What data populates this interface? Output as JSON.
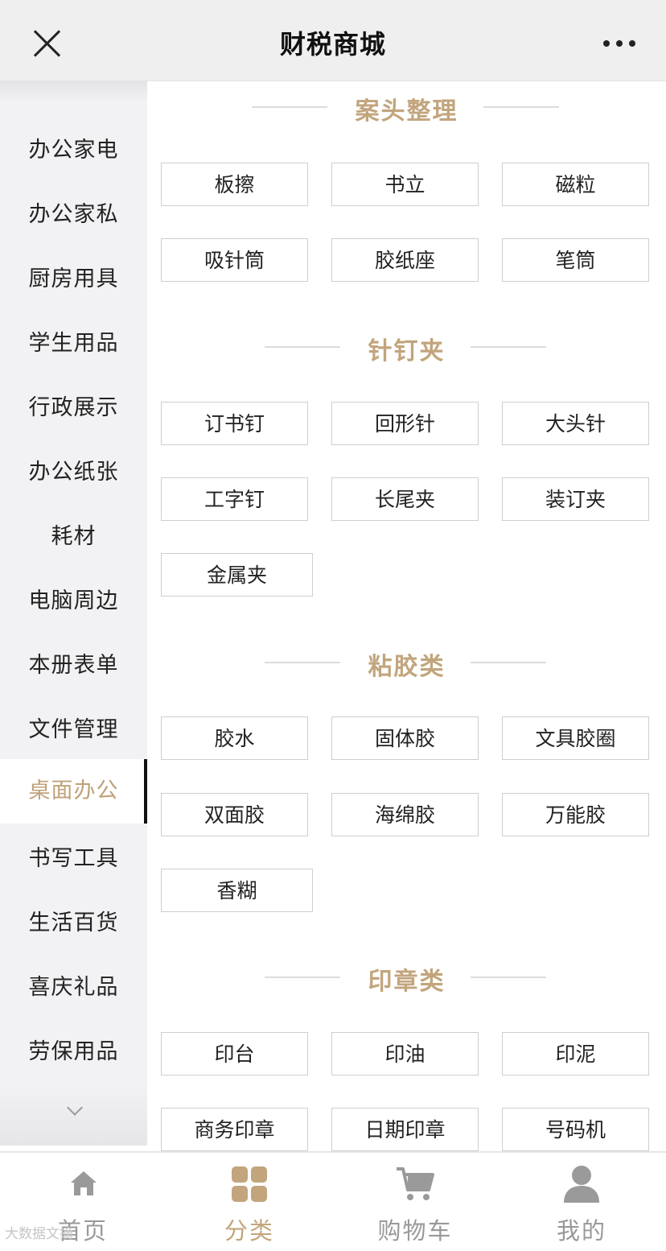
{
  "header": {
    "title": "财税商城"
  },
  "sidebar": {
    "items": [
      {
        "label": "办公家电"
      },
      {
        "label": "办公家私"
      },
      {
        "label": "厨房用具"
      },
      {
        "label": "学生用品"
      },
      {
        "label": "行政展示"
      },
      {
        "label": "办公纸张"
      },
      {
        "label": "耗材"
      },
      {
        "label": "电脑周边"
      },
      {
        "label": "本册表单"
      },
      {
        "label": "文件管理"
      },
      {
        "label": "桌面办公",
        "active": true
      },
      {
        "label": "书写工具"
      },
      {
        "label": "生活百货"
      },
      {
        "label": "喜庆礼品"
      },
      {
        "label": "劳保用品"
      }
    ]
  },
  "sections": [
    {
      "title": "案头整理",
      "items": [
        "板擦",
        "书立",
        "磁粒",
        "吸针筒",
        "胶纸座",
        "笔筒"
      ]
    },
    {
      "title": "针钉夹",
      "items": [
        "订书钉",
        "回形针",
        "大头针",
        "工字钉",
        "长尾夹",
        "装订夹",
        "金属夹"
      ]
    },
    {
      "title": "粘胶类",
      "items": [
        "胶水",
        "固体胶",
        "文具胶圈",
        "双面胶",
        "海绵胶",
        "万能胶",
        "香糊"
      ]
    },
    {
      "title": "印章类",
      "items": [
        "印台",
        "印油",
        "印泥",
        "商务印章",
        "日期印章",
        "号码机"
      ]
    }
  ],
  "tabbar": {
    "tabs": [
      {
        "label": "首页",
        "icon": "home-icon"
      },
      {
        "label": "分类",
        "icon": "grid-icon",
        "active": true
      },
      {
        "label": "购物车",
        "icon": "cart-icon"
      },
      {
        "label": "我的",
        "icon": "user-icon"
      }
    ]
  },
  "colors": {
    "accent": "#c2a57d",
    "header_bg": "#efefef",
    "sidebar_bg": "#f2f2f4",
    "inactive_tab": "#999999"
  },
  "watermark": "大数据文摘"
}
